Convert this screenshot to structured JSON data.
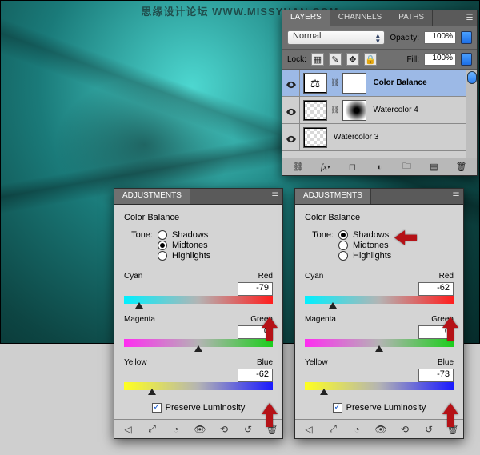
{
  "watermark": "思缘设计论坛  WWW.MISSYUAN.COM",
  "layers": {
    "tabs": [
      "LAYERS",
      "CHANNELS",
      "PATHS"
    ],
    "activeTab": 0,
    "blendMode": "Normal",
    "opacityLabel": "Opacity:",
    "opacityValue": "100%",
    "lockLabel": "Lock:",
    "fillLabel": "Fill:",
    "fillValue": "100%",
    "lockIcons": [
      "transparency-lock",
      "paint-lock",
      "move-lock",
      "all-lock"
    ],
    "items": [
      {
        "name": "Color Balance",
        "active": true,
        "hasMask": true,
        "thumb": "color-balance-adjustment"
      },
      {
        "name": "Watercolor 4",
        "active": false,
        "hasMask": true,
        "thumb": "watercolor4"
      },
      {
        "name": "Watercolor 3",
        "active": false,
        "hasMask": false,
        "thumb": "watercolor3"
      }
    ],
    "footerIcons": [
      "link",
      "fx",
      "mask",
      "adjustment",
      "group",
      "new",
      "trash"
    ]
  },
  "adjLeft": {
    "tab": "ADJUSTMENTS",
    "title": "Color Balance",
    "toneLabel": "Tone:",
    "tone": {
      "shadows": "Shadows",
      "midtones": "Midtones",
      "highlights": "Highlights",
      "selected": "midtones"
    },
    "sliders": [
      {
        "left": "Cyan",
        "right": "Red",
        "value": "-79",
        "handlePct": 10
      },
      {
        "left": "Magenta",
        "right": "Green",
        "value": "0",
        "handlePct": 50
      },
      {
        "left": "Yellow",
        "right": "Blue",
        "value": "-62",
        "handlePct": 19
      }
    ],
    "preserve": "Preserve Luminosity",
    "preserveChecked": true
  },
  "adjRight": {
    "tab": "ADJUSTMENTS",
    "title": "Color Balance",
    "toneLabel": "Tone:",
    "tone": {
      "shadows": "Shadows",
      "midtones": "Midtones",
      "highlights": "Highlights",
      "selected": "shadows"
    },
    "sliders": [
      {
        "left": "Cyan",
        "right": "Red",
        "value": "-62",
        "handlePct": 19
      },
      {
        "left": "Magenta",
        "right": "Green",
        "value": "0",
        "handlePct": 50
      },
      {
        "left": "Yellow",
        "right": "Blue",
        "value": "-73",
        "handlePct": 13
      }
    ],
    "preserve": "Preserve Luminosity",
    "preserveChecked": true
  },
  "annotations": {
    "leftArrows": [
      {
        "slider": 0
      },
      {
        "slider": 2
      }
    ],
    "rightArrows": [
      {
        "tone": true
      },
      {
        "slider": 0
      },
      {
        "slider": 2
      }
    ]
  },
  "colors": {
    "arrow": "#b51217"
  }
}
